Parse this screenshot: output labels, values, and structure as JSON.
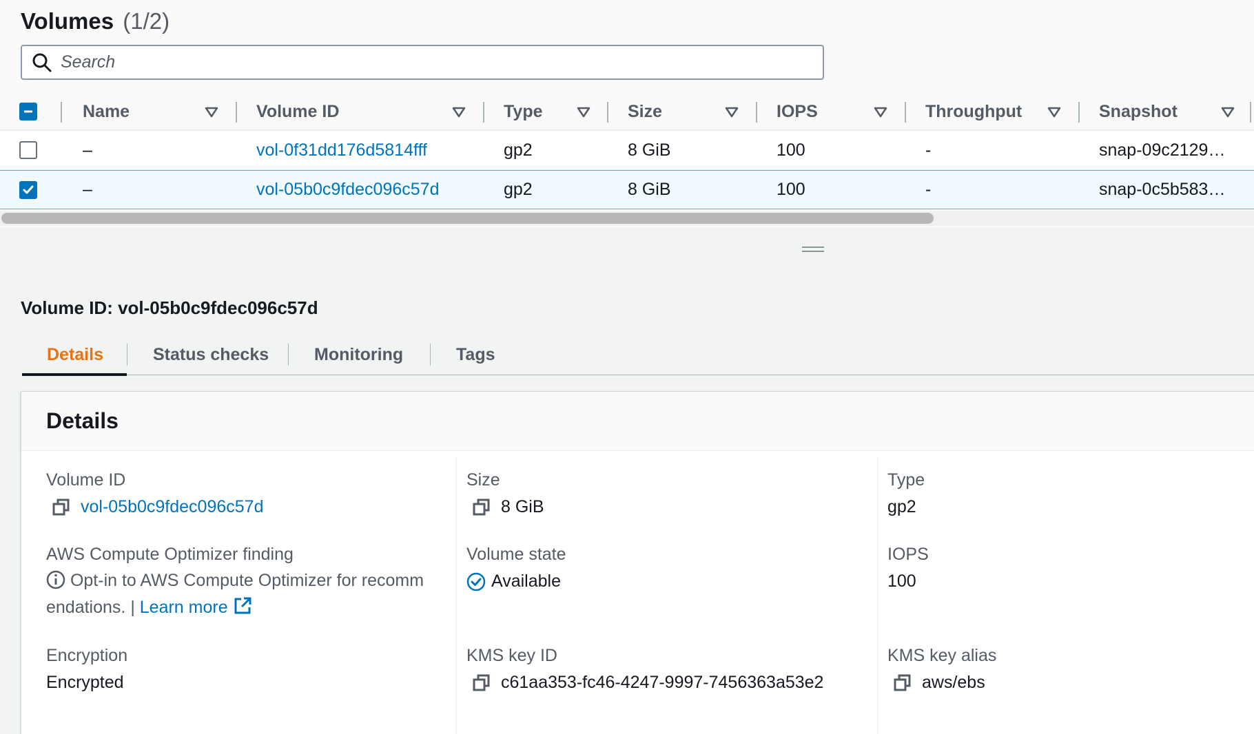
{
  "header": {
    "title": "Volumes",
    "count": "(1/2)"
  },
  "search": {
    "placeholder": "Search"
  },
  "table": {
    "columns": [
      "Name",
      "Volume ID",
      "Type",
      "Size",
      "IOPS",
      "Throughput",
      "Snapshot"
    ],
    "rows": [
      {
        "selected": false,
        "name": "–",
        "volume_id": "vol-0f31dd176d5814fff",
        "type": "gp2",
        "size": "8 GiB",
        "iops": "100",
        "throughput": "-",
        "snapshot": "snap-09c2129…"
      },
      {
        "selected": true,
        "name": "–",
        "volume_id": "vol-05b0c9fdec096c57d",
        "type": "gp2",
        "size": "8 GiB",
        "iops": "100",
        "throughput": "-",
        "snapshot": "snap-0c5b583…"
      }
    ]
  },
  "detail": {
    "title": "Volume ID: vol-05b0c9fdec096c57d",
    "tabs": [
      "Details",
      "Status checks",
      "Monitoring",
      "Tags"
    ],
    "active_tab": "Details",
    "panel_title": "Details",
    "fields": {
      "volume_id": {
        "label": "Volume ID",
        "value": "vol-05b0c9fdec096c57d"
      },
      "optimizer": {
        "label": "AWS Compute Optimizer finding",
        "value_line1": "Opt-in to AWS Compute Optimizer for recomm",
        "value_line2": "endations. |",
        "link": "Learn more"
      },
      "encryption": {
        "label": "Encryption",
        "value": "Encrypted"
      },
      "size": {
        "label": "Size",
        "value": "8 GiB"
      },
      "volume_state": {
        "label": "Volume state",
        "value": "Available"
      },
      "kms_key_id": {
        "label": "KMS key ID",
        "value": "c61aa353-fc46-4247-9997-7456363a53e2"
      },
      "type": {
        "label": "Type",
        "value": "gp2"
      },
      "iops": {
        "label": "IOPS",
        "value": "100"
      },
      "kms_key_alias": {
        "label": "KMS key alias",
        "value": "aws/ebs"
      }
    }
  },
  "colors": {
    "link": "#0073bb",
    "active_tab": "#ec7211",
    "selected_row": "#f1faff"
  },
  "icons": [
    "search-icon",
    "sort-icon",
    "copy-icon",
    "info-icon",
    "external-link-icon",
    "status-check-icon",
    "resize-handle-icon"
  ]
}
